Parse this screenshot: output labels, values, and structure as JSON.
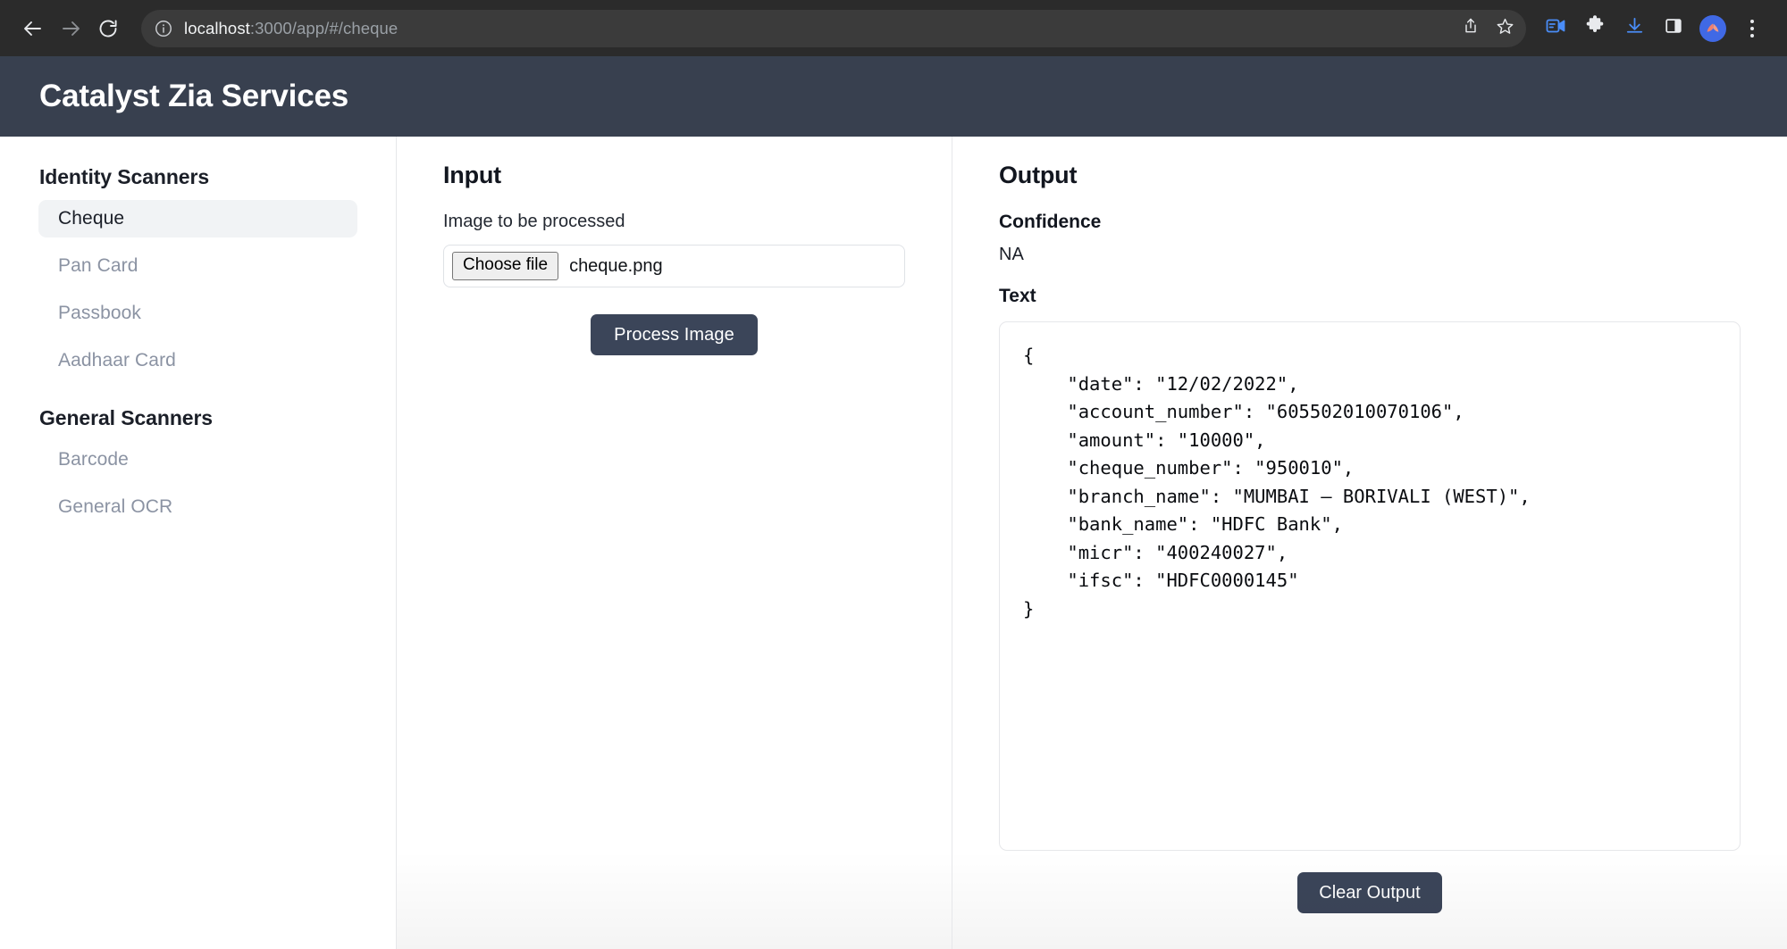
{
  "browser": {
    "back_icon": "arrow-left-icon",
    "forward_icon": "arrow-right-icon",
    "reload_icon": "reload-icon",
    "site_info_icon": "info-circle-icon",
    "url_host": "localhost",
    "url_rest": ":3000/app/#/cheque",
    "url_full": "localhost:3000/app/#/cheque",
    "toolbar_icons": [
      "share-icon",
      "bookmark-star-icon",
      "screen-recorder-icon",
      "extensions-puzzle-icon",
      "downloads-icon",
      "side-panel-icon",
      "profile-avatar-icon",
      "more-menu-kebab-icon"
    ]
  },
  "header": {
    "title": "Catalyst Zia Services"
  },
  "sidebar": {
    "groups": [
      {
        "title": "Identity Scanners",
        "items": [
          {
            "label": "Cheque",
            "active": true
          },
          {
            "label": "Pan Card",
            "active": false
          },
          {
            "label": "Passbook",
            "active": false
          },
          {
            "label": "Aadhaar Card",
            "active": false
          }
        ]
      },
      {
        "title": "General Scanners",
        "items": [
          {
            "label": "Barcode",
            "active": false
          },
          {
            "label": "General OCR",
            "active": false
          }
        ]
      }
    ]
  },
  "input_panel": {
    "heading": "Input",
    "field_label": "Image to be processed",
    "choose_file_label": "Choose file",
    "file_name": "cheque.png",
    "process_button": "Process Image"
  },
  "output_panel": {
    "heading": "Output",
    "confidence_label": "Confidence",
    "confidence_value": "NA",
    "text_label": "Text",
    "result_json": "{\n    \"date\": \"12/02/2022\",\n    \"account_number\": \"605502010070106\",\n    \"amount\": \"10000\",\n    \"cheque_number\": \"950010\",\n    \"branch_name\": \"MUMBAI – BORIVALI (WEST)\",\n    \"bank_name\": \"HDFC Bank\",\n    \"micr\": \"400240027\",\n    \"ifsc\": \"HDFC0000145\"\n}",
    "result_fields": {
      "date": "12/02/2022",
      "account_number": "605502010070106",
      "amount": "10000",
      "cheque_number": "950010",
      "branch_name": "MUMBAI – BORIVALI (WEST)",
      "bank_name": "HDFC Bank",
      "micr": "400240027",
      "ifsc": "HDFC0000145"
    },
    "clear_button": "Clear Output"
  },
  "colors": {
    "app_header_bg": "#38404f",
    "button_dark": "#3b4559",
    "browser_chrome_bg": "#2b2b2b",
    "omnibox_bg": "#3b3b3b",
    "active_item_bg": "#f1f3f5",
    "muted_text": "#8b93a3",
    "divider": "#e6e7ea"
  }
}
